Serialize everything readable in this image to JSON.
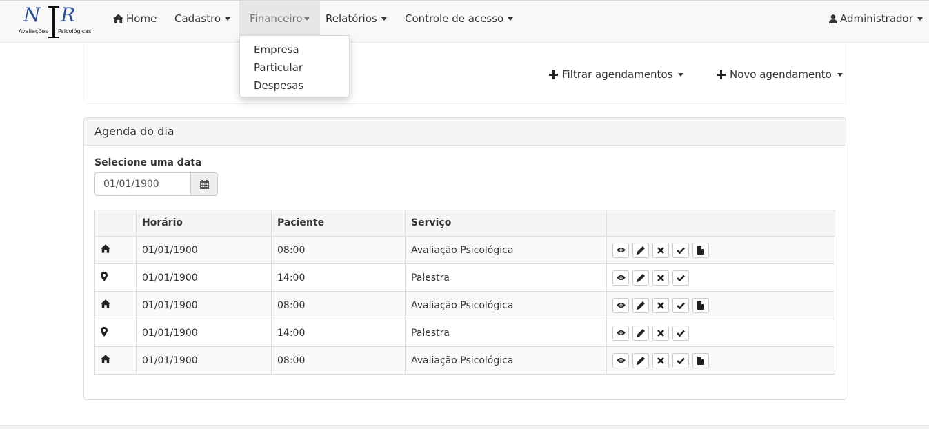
{
  "brand": {
    "logo_text": "Avaliações Psicológicas"
  },
  "nav": {
    "home": "Home",
    "cadastro": "Cadastro",
    "financeiro": "Financeiro",
    "relatorios": "Relatórios",
    "controle": "Controle de acesso",
    "user": "Administrador"
  },
  "financeiro_menu": [
    "Empresa",
    "Particular",
    "Despesas"
  ],
  "toolbar": {
    "filter_label": "Filtrar agendamentos",
    "new_label": "Novo agendamento"
  },
  "panel": {
    "title": "Agenda do dia",
    "date_label": "Selecione uma data",
    "date_value": "01/01/1900"
  },
  "table": {
    "headers": [
      "",
      "Horário",
      "Paciente",
      "Serviço",
      ""
    ],
    "rows": [
      {
        "icon": "home-icon",
        "c1": "01/01/1900",
        "c2": "08:00",
        "c3": "Avaliação Psicológica"
      },
      {
        "icon": "map-marker-icon",
        "c1": "01/01/1900",
        "c2": "14:00",
        "c3": "Palestra"
      },
      {
        "icon": "home-icon",
        "c1": "01/01/1900",
        "c2": "08:00",
        "c3": "Avaliação Psicológica"
      },
      {
        "icon": "map-marker-icon",
        "c1": "01/01/1900",
        "c2": "14:00",
        "c3": "Palestra"
      },
      {
        "icon": "home-icon",
        "c1": "01/01/1900",
        "c2": "08:00",
        "c3": "Avaliação Psicológica"
      }
    ]
  },
  "colors": {
    "navbar_bg": "#f8f8f8",
    "panel_heading_bg": "#f5f5f5",
    "logo_blue": "#2a4d8f"
  }
}
